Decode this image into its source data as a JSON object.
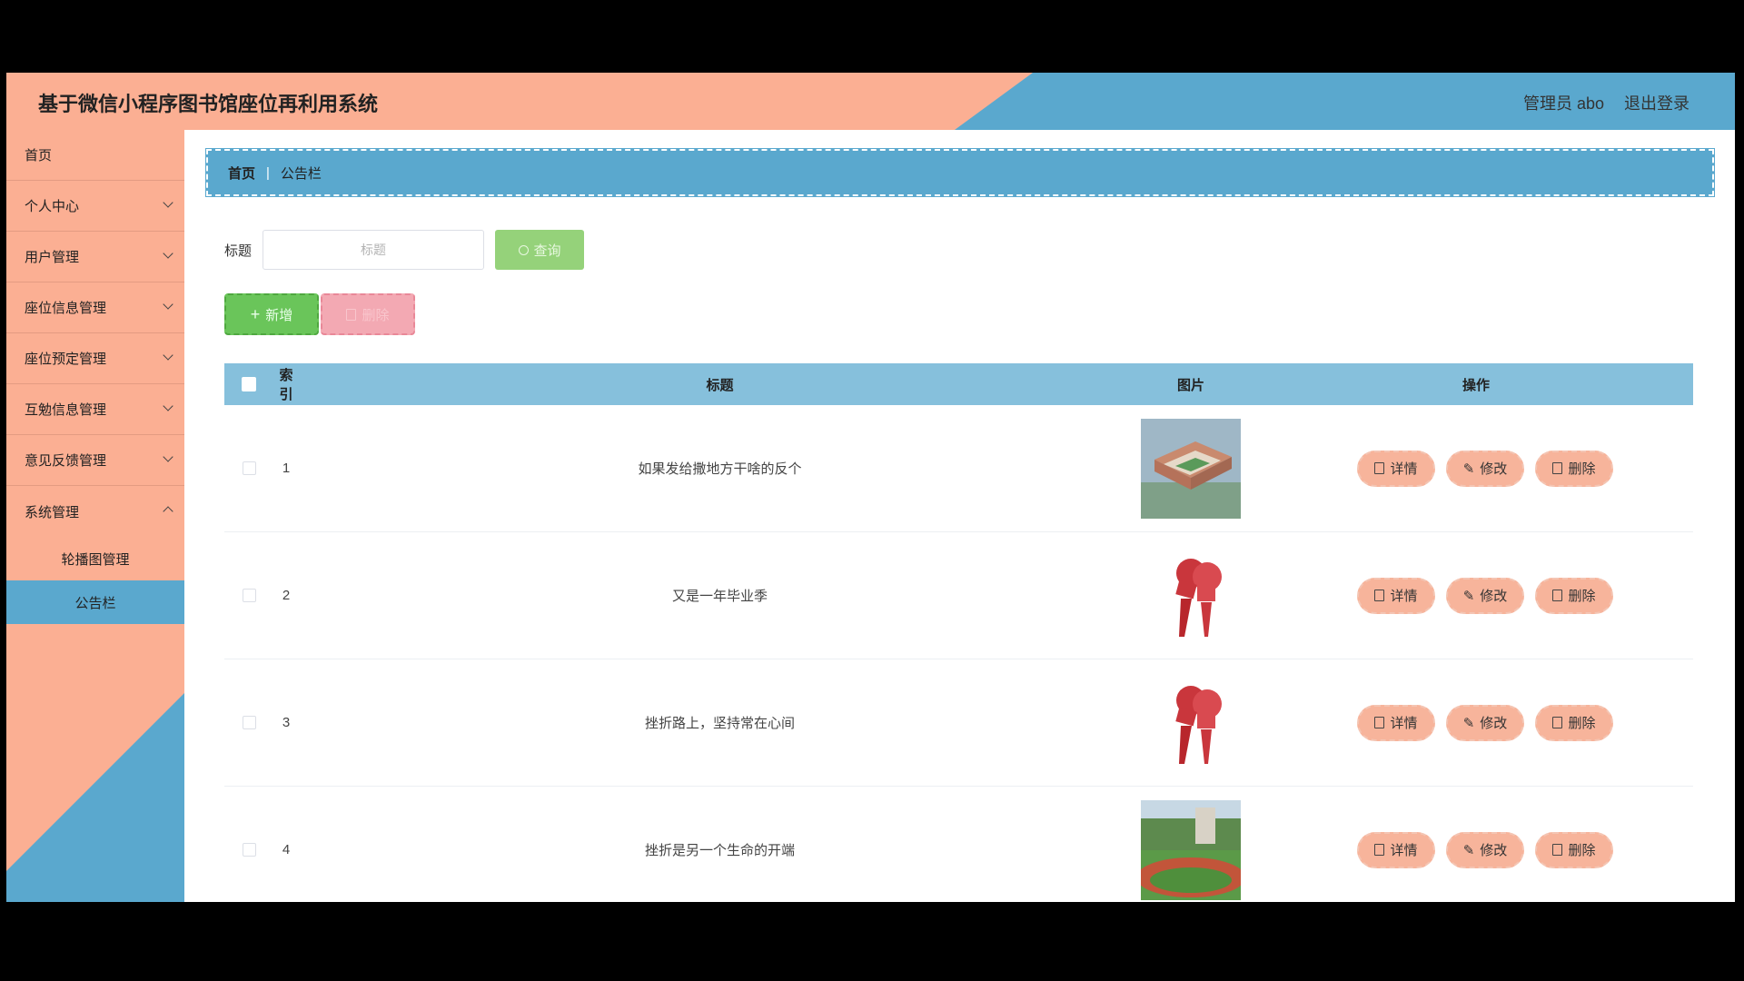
{
  "app": {
    "title": "基于微信小程序图书馆座位再利用系统",
    "user_label": "管理员 abo",
    "logout_label": "退出登录"
  },
  "sidebar": {
    "items": [
      {
        "label": "首页",
        "has_children": false
      },
      {
        "label": "个人中心",
        "has_children": true
      },
      {
        "label": "用户管理",
        "has_children": true
      },
      {
        "label": "座位信息管理",
        "has_children": true
      },
      {
        "label": "座位预定管理",
        "has_children": true
      },
      {
        "label": "互勉信息管理",
        "has_children": true
      },
      {
        "label": "意见反馈管理",
        "has_children": true
      },
      {
        "label": "系统管理",
        "has_children": true
      }
    ],
    "sub_items": [
      {
        "label": "轮播图管理",
        "active": false
      },
      {
        "label": "公告栏",
        "active": true
      }
    ]
  },
  "breadcrumb": {
    "home": "首页",
    "separator": "|",
    "current": "公告栏"
  },
  "search": {
    "label": "标题",
    "placeholder": "标题",
    "button_label": "查询"
  },
  "actions": {
    "add_label": "新增",
    "delete_label": "删除"
  },
  "table": {
    "headers": {
      "index": "索引",
      "title": "标题",
      "image": "图片",
      "operations": "操作"
    },
    "rows": [
      {
        "index": "1",
        "title": "如果发给撒地方干啥的反个",
        "image": "campus-building-photo"
      },
      {
        "index": "2",
        "title": "又是一年毕业季",
        "image": "news-microphones-icon"
      },
      {
        "index": "3",
        "title": "挫折路上，坚持常在心间",
        "image": "news-microphones-icon"
      },
      {
        "index": "4",
        "title": "挫折是另一个生命的开端",
        "image": "sports-field-photo"
      }
    ],
    "op_labels": {
      "detail": "详情",
      "edit": "修改",
      "delete": "删除"
    }
  },
  "colors": {
    "orange": "#fbaf93",
    "blue": "#5aa8ce",
    "table_header": "#86c0dc",
    "query_button": "#95d27a",
    "add_button": "#6ac55a",
    "delete_button": "#f3a9b3"
  }
}
